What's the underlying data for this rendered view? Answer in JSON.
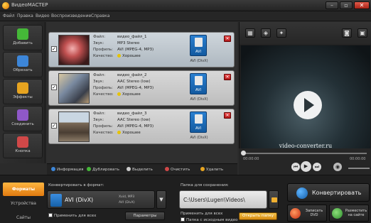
{
  "window": {
    "title": "ВидеоМАСТЕР"
  },
  "menu": [
    "Файл",
    "Правка",
    "Видео",
    "Воспроизведение",
    "Справка"
  ],
  "rail": [
    {
      "label": "Добавить",
      "color": "#45b838"
    },
    {
      "label": "Обрезать",
      "color": "#3d86d8"
    },
    {
      "label": "Эффекты",
      "color": "#e7a420"
    },
    {
      "label": "Соединить",
      "color": "#8f58c8"
    },
    {
      "label": "Кнопка",
      "color": "#d04848"
    }
  ],
  "file_keys": {
    "file": "Файл:",
    "sound": "Звук:",
    "profile": "Профиль:",
    "quality": "Качество:"
  },
  "files": [
    {
      "file": "видео_файл_1",
      "sound": "MP3 Stereo",
      "profile": "AVI (MPEG-4, MP3)",
      "quality": "Хорошее",
      "fmt_label": "AVI",
      "fmt_sub": "AVI (DivX)"
    },
    {
      "file": "видео_файл_2",
      "sound": "AAC Stereo (low)",
      "profile": "AVI (MPEG-4, MP3)",
      "quality": "Хорошее",
      "fmt_label": "AVI",
      "fmt_sub": "AVI (DivX)"
    },
    {
      "file": "видео_файл_3",
      "sound": "AAC Stereo (low)",
      "profile": "AVI (MPEG-4, MP3)",
      "quality": "Хорошее",
      "fmt_label": "AVI",
      "fmt_sub": "AVI (DivX)"
    }
  ],
  "list_toolbar": [
    {
      "label": "Информация",
      "color": "#3d86d8"
    },
    {
      "label": "Дублировать",
      "color": "#45b838"
    },
    {
      "label": "Выделить",
      "color": "#cccccc"
    },
    {
      "label": "Очистить",
      "color": "#d04848"
    },
    {
      "label": "Удалить",
      "color": "#e7a420"
    }
  ],
  "preview": {
    "watermark": "video-converter.ru",
    "time_start": "00:00:00",
    "time_end": "00:00:00"
  },
  "bottom": {
    "tabs": [
      "Форматы",
      "Устройства",
      "Сайты"
    ],
    "format_label": "Конвертировать в формат:",
    "format_name": "AVI (DivX)",
    "format_detail_1": "Xvid, MP3",
    "format_detail_2": "AVI (DivX)",
    "apply_all": "Применить для всех",
    "params_btn": "Параметры",
    "folder_label": "Папка для сохранения:",
    "path": "C:\\Users\\Lugen\\Videos\\",
    "apply_all_2": "Применить для всех",
    "source_folder": "Папка с исходным видео",
    "open_folder": "Открыть папку",
    "convert": "Конвертировать",
    "share_1": "Записать DVD",
    "share_2": "Разместить на сайте"
  }
}
